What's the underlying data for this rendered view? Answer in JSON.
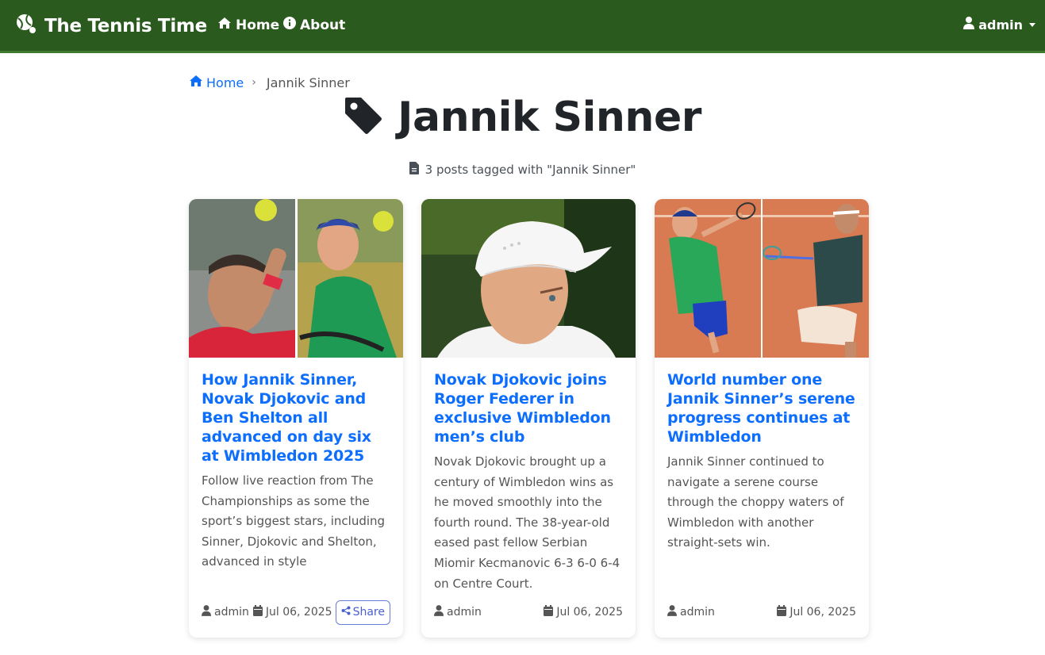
{
  "navbar": {
    "brand": "The Tennis Time",
    "links": [
      {
        "label": "Home",
        "icon": "home-icon"
      },
      {
        "label": "About",
        "icon": "info-circle-icon"
      }
    ],
    "user": "admin"
  },
  "breadcrumb": {
    "home": "Home",
    "separator": "›",
    "current": "Jannik Sinner"
  },
  "page": {
    "title": "Jannik Sinner",
    "subtitle": "3 posts tagged with \"Jannik Sinner\""
  },
  "posts": [
    {
      "title": "How Jannik Sinner, Novak Djokovic and Ben Shelton all advanced on day six at Wimbledon 2025",
      "excerpt": "Follow live reaction from The Championships as some the sport’s biggest stars, including Sinner, Djokovic and Shelton, advanced in style",
      "author": "admin",
      "date": "Jul 06, 2025",
      "share": "Share"
    },
    {
      "title": "Novak Djokovic joins Roger Federer in exclusive Wimbledon men’s club",
      "excerpt": "Novak Djokovic brought up a century of Wimbledon wins as he moved smoothly into the fourth round. The 38-year-old eased past fellow Serbian Miomir Kecmanovic 6-3 6-0 6-4 on Centre Court.",
      "author": "admin",
      "date": "Jul 06, 2025"
    },
    {
      "title": "World number one Jannik Sinner’s serene progress continues at Wimbledon",
      "excerpt": "Jannik Sinner continued to navigate a serene course through the choppy waters of Wimbledon with another straight-sets win.",
      "author": "admin",
      "date": "Jul 06, 2025"
    }
  ],
  "colors": {
    "navbar": "#2b5a1f",
    "link": "#0d6efd",
    "share": "#4a60d0"
  }
}
